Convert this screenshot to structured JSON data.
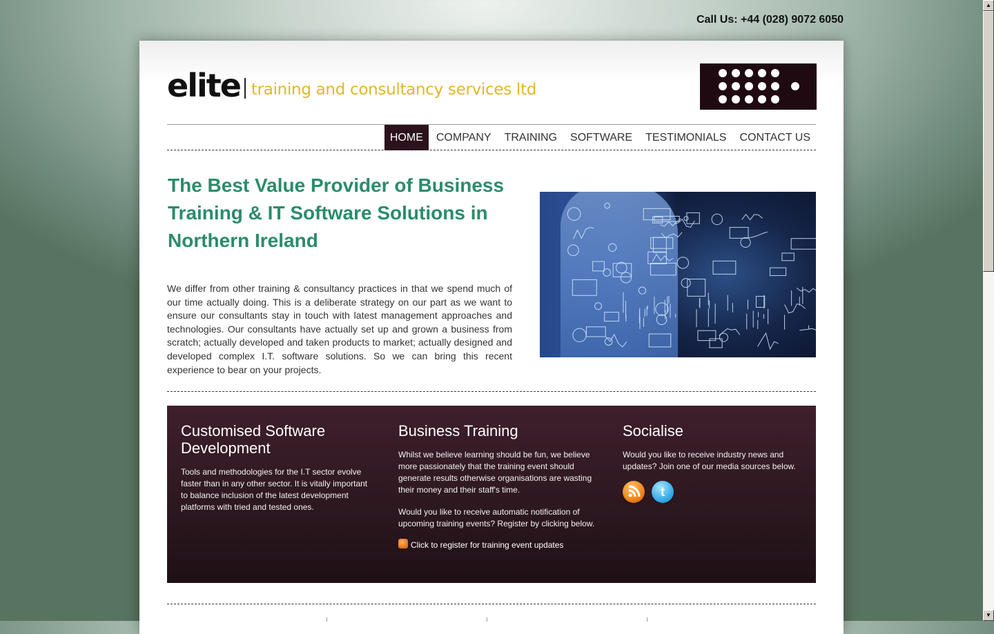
{
  "header": {
    "call_us": "Call Us: +44 (028) 9072 6050",
    "logo_brand": "elite",
    "logo_tagline": "training and consultancy services ltd"
  },
  "nav": {
    "items": [
      {
        "label": "HOME",
        "active": true
      },
      {
        "label": "COMPANY",
        "active": false
      },
      {
        "label": "TRAINING",
        "active": false
      },
      {
        "label": "SOFTWARE",
        "active": false
      },
      {
        "label": "TESTIMONIALS",
        "active": false
      },
      {
        "label": "CONTACT US",
        "active": false
      }
    ]
  },
  "main": {
    "headline": "The Best Value Provider of Business Training & IT Software Solutions in Northern Ireland",
    "intro": "We differ from other training & consultancy practices in that we spend much of our time actually doing. This is a deliberate strategy on our part as we want to ensure our consultants stay in touch with latest management approaches and technologies. Our consultants have actually set up and grown a business from scratch; actually developed and taken products to market; actually designed and developed complex I.T. software solutions. So we can bring this recent experience to bear on your projects.",
    "hero_image": "businesswoman-drawing-digital-charts-image"
  },
  "panel": {
    "software": {
      "title": "Customised Software Development",
      "text": "Tools and methodologies for the I.T sector evolve faster than in any other sector. It is vitally important to balance inclusion of the latest development platforms with tried and tested ones."
    },
    "training": {
      "title": "Business Training",
      "text1": "Whilst we believe learning should be fun, we believe more passionately that the training event should generate results otherwise organisations are wasting their money and their staff's time.",
      "text2": "Would you like to receive automatic notification of upcoming training events? Register by clicking below.",
      "register_link": "Click to register for training event updates"
    },
    "socialise": {
      "title": "Socialise",
      "text": "Would you like to receive industry news and updates? Join one of our media sources below.",
      "icons": [
        "rss-icon",
        "twitter-icon"
      ]
    }
  },
  "colors": {
    "accent_green": "#2a8c6a",
    "logo_yellow": "#e2b72a",
    "nav_active": "#2c121c",
    "panel_bg": "#2d1820"
  }
}
